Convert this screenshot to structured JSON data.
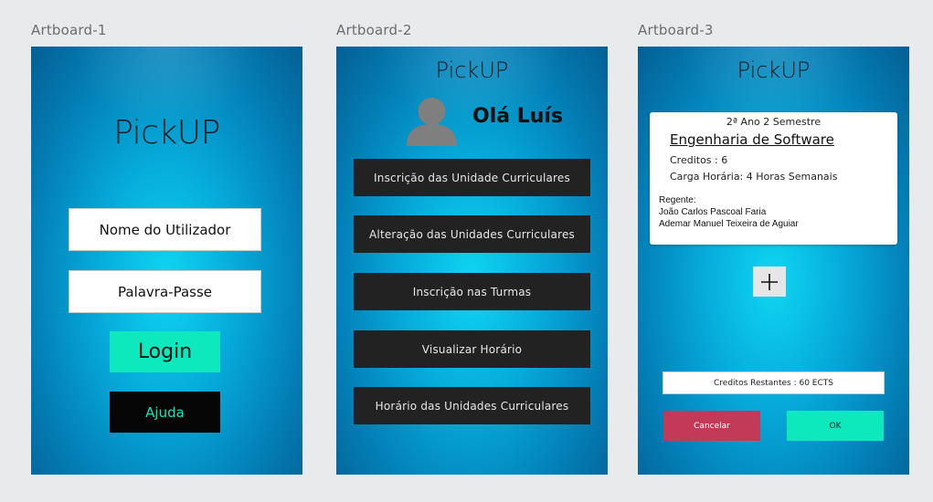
{
  "artboards": [
    {
      "label": "Artboard-1"
    },
    {
      "label": "Artboard-2"
    },
    {
      "label": "Artboard-3"
    }
  ],
  "login_screen": {
    "app_name": "PickUP",
    "username_placeholder": "Nome do Utilizador",
    "password_placeholder": "Palavra-Passe",
    "login_label": "Login",
    "help_label": "Ajuda"
  },
  "menu_screen": {
    "app_name": "PickUP",
    "greeting": "Olá Luís",
    "avatar_icon": "user-avatar-icon",
    "items": [
      {
        "label": "Inscrição das Unidade Curriculares"
      },
      {
        "label": "Alteração das Unidades Curriculares"
      },
      {
        "label": "Inscrição nas Turmas"
      },
      {
        "label": "Visualizar Horário"
      },
      {
        "label": "Horário das Unidades Curriculares"
      }
    ]
  },
  "course_screen": {
    "app_name": "PickUP",
    "card": {
      "year_semester": "2ª Ano 2 Semestre",
      "course_name": "Engenharia de Software",
      "credits": "Creditos : 6",
      "workload": "Carga Horária: 4 Horas Semanais",
      "regent_label": "Regente:",
      "regents": [
        "João Carlos Pascoal Faria",
        "Ademar Manuel Teixeira de Aguiar"
      ]
    },
    "add_icon": "plus-icon",
    "remaining_credits": "Creditos Restantes :  60 ECTS",
    "cancel_label": "Cancelar",
    "ok_label": "OK"
  },
  "colors": {
    "accent": "#0de9bd",
    "cancel": "#c33a58",
    "menu_button": "#222222",
    "background": "#e9eaeb"
  }
}
